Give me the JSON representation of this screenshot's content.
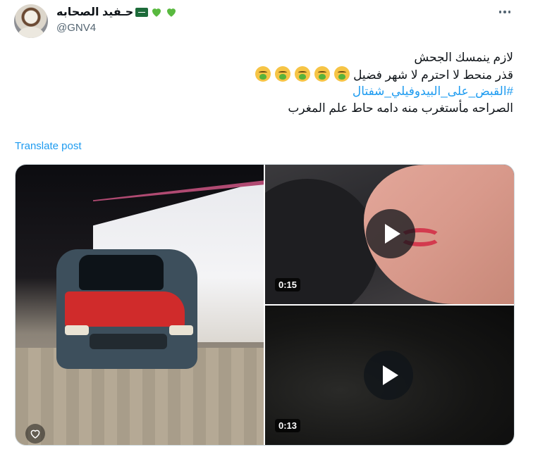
{
  "author": {
    "display_name": "حـفيد الصحابه",
    "handle": "@GNV4",
    "badges": [
      "flag-icon",
      "green-heart-icon",
      "green-heart-icon"
    ]
  },
  "tweet": {
    "line1": "لازم ينمسك الجحش",
    "line2": "قذر منحط لا احترم لا شهر فضيل",
    "emoji_count": 5,
    "emoji": "face-vomiting-icon",
    "hashtag": "#القبض_على_البيدوفيلي_شفتال",
    "line4": "الصراحه مأستغرب منه دامه حاط علم المغرب"
  },
  "translate_label": "Translate post",
  "media": {
    "video1_duration": "0:15",
    "video2_duration": "0:13"
  },
  "colors": {
    "link": "#1d9bf0",
    "text": "#0f1419",
    "muted": "#536471",
    "heart_green": "#59b93f"
  }
}
